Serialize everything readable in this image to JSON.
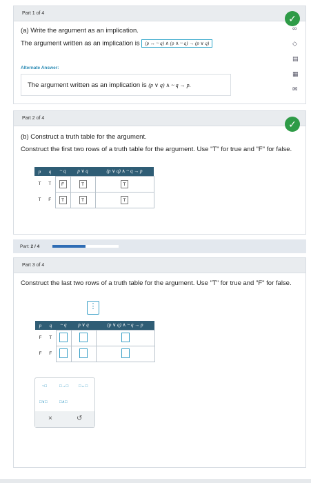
{
  "part1": {
    "header": "Part 1 of 4",
    "question": "(a) Write the argument as an implication.",
    "answer_prefix": "The argument written as an implication is",
    "answer_formula": "(p ↔ ~ q) ∧ (p ∧ ~ q) → (p ∨ q)",
    "alt_title": "Alternate Answer:",
    "alt_prefix": "The argument written as an implication is",
    "alt_formula": "(p ∨ q) ∧ ~ q → p."
  },
  "part2": {
    "header": "Part 2 of 4",
    "question": "(b) Construct a truth table for the argument.",
    "instruction": "Construct the first two rows of a truth table for the argument. Use \"T\" for true and \"F\" for false.",
    "columns": [
      "p",
      "q",
      "~ q",
      "p ∨ q",
      "(p ∨ q) ∧ ~ q → p"
    ],
    "rows": [
      [
        "T",
        "T",
        "F",
        "T",
        "T"
      ],
      [
        "T",
        "F",
        "T",
        "T",
        "T"
      ]
    ]
  },
  "progress": {
    "label": "Part:",
    "value": "2 / 4",
    "fraction": 0.5
  },
  "part3": {
    "header": "Part 3 of 4",
    "instruction": "Construct the last two rows of a truth table for the argument. Use \"T\" for true and \"F\" for false.",
    "columns": [
      "p",
      "q",
      "~ q",
      "p ∨ q",
      "(p ∨ q) ∧ ~ q → p"
    ],
    "rows": [
      [
        "F",
        "T"
      ],
      [
        "F",
        "F"
      ]
    ]
  },
  "palette": {
    "btn_not": "~□",
    "btn_imp": "□→□",
    "btn_bicond": "□↔□",
    "btn_or": "□∨□",
    "btn_and": "□∧□",
    "btn_clear": "×",
    "btn_undo": "↺"
  },
  "icons": {
    "check": "✓",
    "infinity": "∞",
    "diamond": "◇",
    "book": "▤",
    "calc": "▦",
    "mail": "✉",
    "grip": "⋮"
  }
}
